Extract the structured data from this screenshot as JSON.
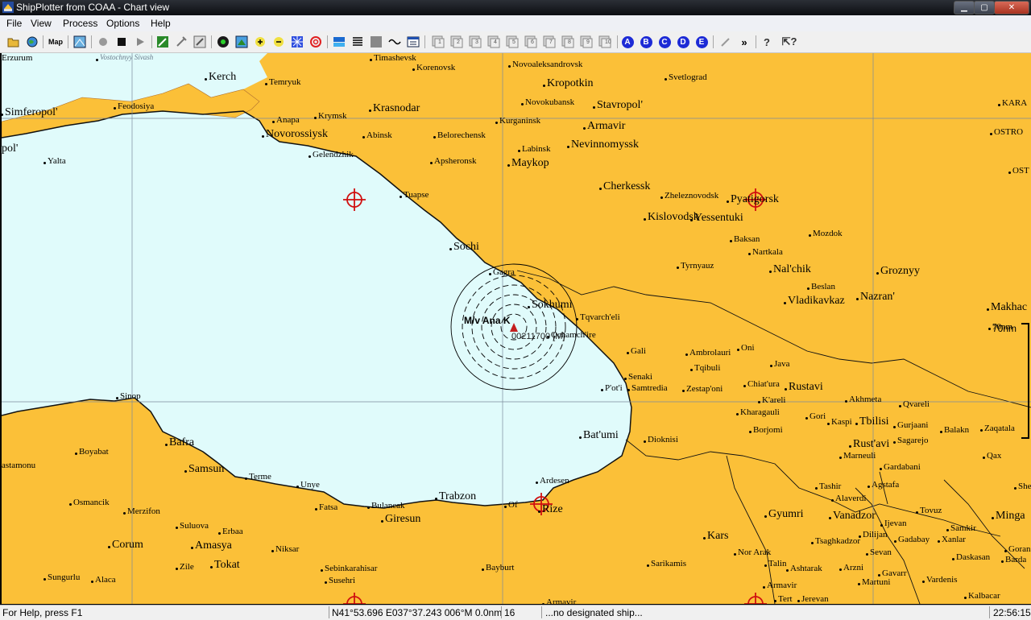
{
  "window": {
    "title": "ShipPlotter from COAA - Chart view",
    "min": "▁",
    "max": "▢",
    "close": "✕"
  },
  "menu": [
    "File",
    "View",
    "Process",
    "Options",
    "Help"
  ],
  "toolbar": {
    "icons": [
      "open-folder-icon",
      "globe-icon",
      "map-icon",
      "chart-icon",
      "record-icon",
      "stop-icon",
      "play-icon",
      "edit-icon",
      "tools-icon",
      "resize-icon",
      "radar-icon",
      "area-icon",
      "zoom-in-icon",
      "zoom-out-icon",
      "grid-icon",
      "target-icon",
      "layers-icon",
      "list-icon",
      "gray-box-icon",
      "wave-icon",
      "window-icon"
    ],
    "map_label": "Map",
    "numbered_views": [
      "1",
      "2",
      "3",
      "4",
      "5",
      "6",
      "7",
      "8",
      "9",
      "10"
    ],
    "lettered_views": [
      "A",
      "B",
      "C",
      "D",
      "E"
    ],
    "help_icons": [
      "pen-icon",
      "fast-forward-icon",
      "help-icon",
      "context-help-icon"
    ]
  },
  "map": {
    "places": [
      {
        "name": "Vostochnyy Sivash",
        "style": "sea"
      },
      {
        "name": "Timashevsk"
      },
      {
        "name": "Korenovsk"
      },
      {
        "name": "Novoaleksandrovsk"
      },
      {
        "name": "Kerch",
        "style": "big"
      },
      {
        "name": "Temryuk"
      },
      {
        "name": "Kropotkin",
        "style": "big"
      },
      {
        "name": "Svetlograd"
      },
      {
        "name": "Simferopol'",
        "style": "big"
      },
      {
        "name": "Feodosiya"
      },
      {
        "name": "Krymsk"
      },
      {
        "name": "Krasnodar",
        "style": "big"
      },
      {
        "name": "Novokubansk"
      },
      {
        "name": "Stavropol'",
        "style": "big"
      },
      {
        "name": "KARA"
      },
      {
        "name": "Anapa"
      },
      {
        "name": "Kurganinsk"
      },
      {
        "name": "Armavir",
        "style": "big"
      },
      {
        "name": "Novorossiysk",
        "style": "big"
      },
      {
        "name": "Abinsk"
      },
      {
        "name": "Belorechensk"
      },
      {
        "name": "Nevinnomyssk",
        "style": "big"
      },
      {
        "name": "OSTRO"
      },
      {
        "name": "pol'",
        "style": "big"
      },
      {
        "name": "Labinsk"
      },
      {
        "name": "Gelendzhik"
      },
      {
        "name": "Yalta"
      },
      {
        "name": "Apsheronsk"
      },
      {
        "name": "Maykop",
        "style": "big"
      },
      {
        "name": "OST"
      },
      {
        "name": "Cherkessk",
        "style": "big"
      },
      {
        "name": "Zheleznovodsk"
      },
      {
        "name": "Pyatigorsk",
        "style": "big"
      },
      {
        "name": "Tuapse"
      },
      {
        "name": "Kislovodsk",
        "style": "big"
      },
      {
        "name": "Yessentuki",
        "style": "big"
      },
      {
        "name": "Mozdok"
      },
      {
        "name": "Baksan"
      },
      {
        "name": "Nartkala"
      },
      {
        "name": "Sochi",
        "style": "big"
      },
      {
        "name": "Tyrnyauz"
      },
      {
        "name": "Nal'chik",
        "style": "big"
      },
      {
        "name": "Groznyy",
        "style": "big"
      },
      {
        "name": "Gagra"
      },
      {
        "name": "Beslan"
      },
      {
        "name": "Makhac",
        "style": "big"
      },
      {
        "name": "Vladikavkaz",
        "style": "big"
      },
      {
        "name": "Nazran'",
        "style": "big"
      },
      {
        "name": "Sokhumi",
        "style": "big"
      },
      {
        "name": "70nm"
      },
      {
        "name": "Tqvarch'eli"
      },
      {
        "name": "Ochamch'ire"
      },
      {
        "name": "Oni"
      },
      {
        "name": "Gali"
      },
      {
        "name": "Ambrolauri"
      },
      {
        "name": "Java"
      },
      {
        "name": "Tqibuli"
      },
      {
        "name": "Senaki"
      },
      {
        "name": "Chiat'ura"
      },
      {
        "name": "Rustavi",
        "style": "big"
      },
      {
        "name": "Samtredia"
      },
      {
        "name": "Zestap'oni"
      },
      {
        "name": "P'ot'i"
      },
      {
        "name": "Akhmeta"
      },
      {
        "name": "K'areli"
      },
      {
        "name": "Qvareli"
      },
      {
        "name": "Sinop"
      },
      {
        "name": "Kharagauli"
      },
      {
        "name": "Gori"
      },
      {
        "name": "Kaspi"
      },
      {
        "name": "Tbilisi",
        "style": "big"
      },
      {
        "name": "Gurjaani"
      },
      {
        "name": "Borjomi"
      },
      {
        "name": "Balakn"
      },
      {
        "name": "Sagarejo"
      },
      {
        "name": "Zaqatala"
      },
      {
        "name": "Bat'umi",
        "style": "big"
      },
      {
        "name": "Dioknisi"
      },
      {
        "name": "Rust'avi",
        "style": "big"
      },
      {
        "name": "Bafra",
        "style": "big"
      },
      {
        "name": "Boyabat"
      },
      {
        "name": "Marneuli"
      },
      {
        "name": "Qax"
      },
      {
        "name": "astamonu"
      },
      {
        "name": "Samsun",
        "style": "big"
      },
      {
        "name": "Gardabani"
      },
      {
        "name": "Terme"
      },
      {
        "name": "Ardesen"
      },
      {
        "name": "Unye"
      },
      {
        "name": "Tashir"
      },
      {
        "name": "Agstafa"
      },
      {
        "name": "Sheki"
      },
      {
        "name": "Trabzon",
        "style": "big"
      },
      {
        "name": "Osmancik"
      },
      {
        "name": "Fatsa"
      },
      {
        "name": "Bulancak"
      },
      {
        "name": "Of"
      },
      {
        "name": "Rize",
        "style": "big"
      },
      {
        "name": "Alaverdi"
      },
      {
        "name": "Merzifon"
      },
      {
        "name": "Giresun",
        "style": "big"
      },
      {
        "name": "Tovuz"
      },
      {
        "name": "Ijevan"
      },
      {
        "name": "Samkir"
      },
      {
        "name": "Suluova"
      },
      {
        "name": "Gyumri",
        "style": "big"
      },
      {
        "name": "Vanadzor",
        "style": "big"
      },
      {
        "name": "Minga",
        "style": "big"
      },
      {
        "name": "Corum",
        "style": "big"
      },
      {
        "name": "Erbaa"
      },
      {
        "name": "Kars",
        "style": "big"
      },
      {
        "name": "Dilijan"
      },
      {
        "name": "Gadabay"
      },
      {
        "name": "Xanlar"
      },
      {
        "name": "Amasya",
        "style": "big"
      },
      {
        "name": "Tsaghkadzor"
      },
      {
        "name": "Goran"
      },
      {
        "name": "Niksar"
      },
      {
        "name": "Nor Arak"
      },
      {
        "name": "Sevan"
      },
      {
        "name": "Daskasan"
      },
      {
        "name": "Barda"
      },
      {
        "name": "Tokat",
        "style": "big"
      },
      {
        "name": "Zile"
      },
      {
        "name": "Sebinkarahisar"
      },
      {
        "name": "Sarikamis"
      },
      {
        "name": "Talin"
      },
      {
        "name": "Ashtarak"
      },
      {
        "name": "Arzni"
      },
      {
        "name": "Gavarr"
      },
      {
        "name": "Bayburt"
      },
      {
        "name": "Sungurlu"
      },
      {
        "name": "Alaca"
      },
      {
        "name": "Susehri"
      },
      {
        "name": "Martuni"
      },
      {
        "name": "Vardenis"
      },
      {
        "name": "Armavir"
      },
      {
        "name": "Kalbacar"
      },
      {
        "name": "Tert"
      },
      {
        "name": "Jerevan"
      },
      {
        "name": "Armavir"
      },
      {
        "name": "Erzurum"
      }
    ],
    "ship": {
      "name": "M/v Ana K",
      "detail": "00211700 [M]"
    },
    "scale_label": "70nm"
  },
  "status": {
    "help": "For Help, press F1",
    "position": "N41°53.696 E037°37.243 006°M 0.0nm",
    "count": "16",
    "ship": "...no designated ship...",
    "time": "22:56:15"
  }
}
